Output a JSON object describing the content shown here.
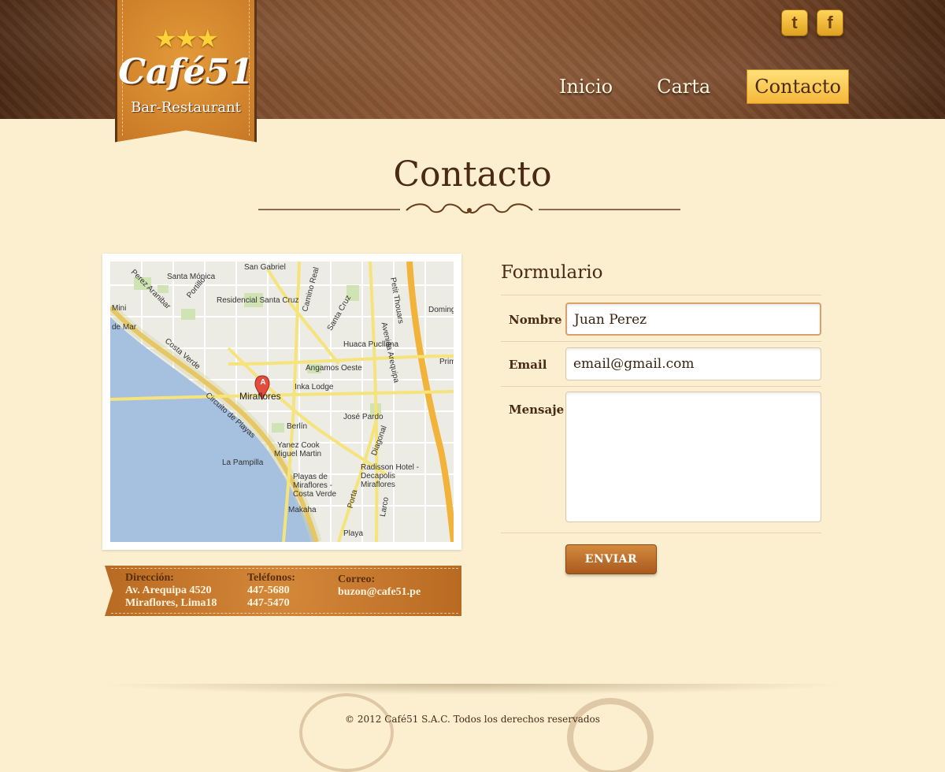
{
  "header": {
    "logo": {
      "stars": "★★★",
      "brand": "Café51",
      "subtitle": "Bar-Restaurant"
    },
    "social": [
      {
        "name": "twitter",
        "icon": "twitter-icon",
        "glyph": "t"
      },
      {
        "name": "facebook",
        "icon": "facebook-icon",
        "glyph": "f"
      }
    ],
    "nav": [
      {
        "label": "Inicio",
        "active": false
      },
      {
        "label": "Carta",
        "active": false
      },
      {
        "label": "Contacto",
        "active": true
      }
    ]
  },
  "page": {
    "title": "Contacto"
  },
  "map": {
    "marker_letter": "A",
    "labels": [
      "San Gabriel",
      "Santa Mónica",
      "Residencial Santa Cruz",
      "Perez Aranibar",
      "Portillo",
      "Mini",
      "de Mar",
      "Camino Real",
      "Santa Cruz",
      "Petit Thouars",
      "Avenida Arequipa",
      "Huaca Pucllana",
      "Domingo",
      "Prim",
      "Angamos Oeste",
      "Inka Lodge",
      "Miraflores",
      "Costa Verde",
      "Circuito de Playas",
      "Berlín",
      "José Pardo",
      "Diagonal",
      "Yanez Cook",
      "Miguel Martin",
      "La Pampilla",
      "Radisson Hotel - Decapolis Miraflores",
      "Playas de Miraflores - Costa Verde",
      "Porta",
      "Larco",
      "Makaha",
      "Playa"
    ]
  },
  "address": {
    "direccion_label": "Dirección:",
    "direccion_line1": "Av. Arequipa 4520",
    "direccion_line2": "Miraflores, Lima18",
    "telefonos_label": "Teléfonos:",
    "telefono1": "447-5680",
    "telefono2": "447-5470",
    "correo_label": "Correo:",
    "correo": "buzon@cafe51.pe"
  },
  "form": {
    "title": "Formulario",
    "name_label": "Nombre",
    "name_value": "Juan Perez",
    "email_label": "Email",
    "email_value": "email@gmail.com",
    "message_label": "Mensaje",
    "message_value": "",
    "submit_label": "ENVIAR"
  },
  "footer": {
    "copyright": "© 2012 Café51 S.A.C. Todos los derechos reservados"
  },
  "colors": {
    "background": "#fbefcf",
    "header": "#7a4a2c",
    "accent": "#f5b73a",
    "ribbon": "#c67624"
  }
}
